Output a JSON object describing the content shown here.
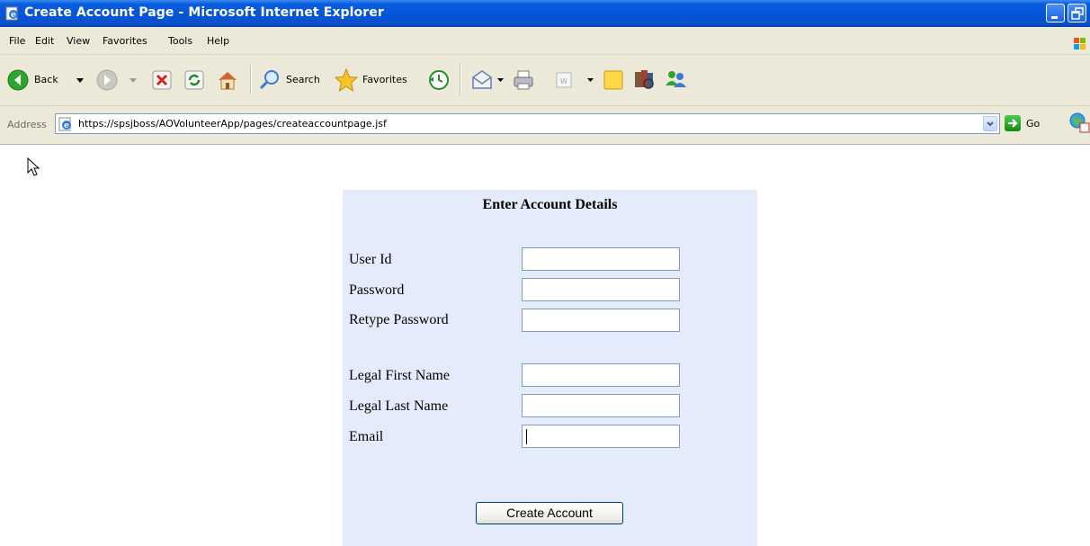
{
  "window": {
    "title": "Create Account Page - Microsoft Internet Explorer"
  },
  "menubar": {
    "items": [
      "File",
      "Edit",
      "View",
      "Favorites",
      "Tools",
      "Help"
    ]
  },
  "toolbar": {
    "back_label": "Back",
    "search_label": "Search",
    "favorites_label": "Favorites"
  },
  "address_bar": {
    "label": "Address",
    "url": "https://spsjboss/AOVolunteerApp/pages/createaccountpage.jsf",
    "go_label": "Go"
  },
  "form": {
    "title": "Enter Account Details",
    "fields": [
      {
        "label": "User Id",
        "value": ""
      },
      {
        "label": "Password",
        "value": ""
      },
      {
        "label": "Retype Password",
        "value": ""
      },
      {
        "label": "Legal First Name",
        "value": ""
      },
      {
        "label": "Legal Last Name",
        "value": ""
      },
      {
        "label": "Email",
        "value": ""
      }
    ],
    "submit_label": "Create Account"
  },
  "colors": {
    "titlebar": "#0556d8",
    "chrome": "#ece9d8",
    "panel": "#e4ecfb",
    "input_border": "#7f9db9"
  }
}
